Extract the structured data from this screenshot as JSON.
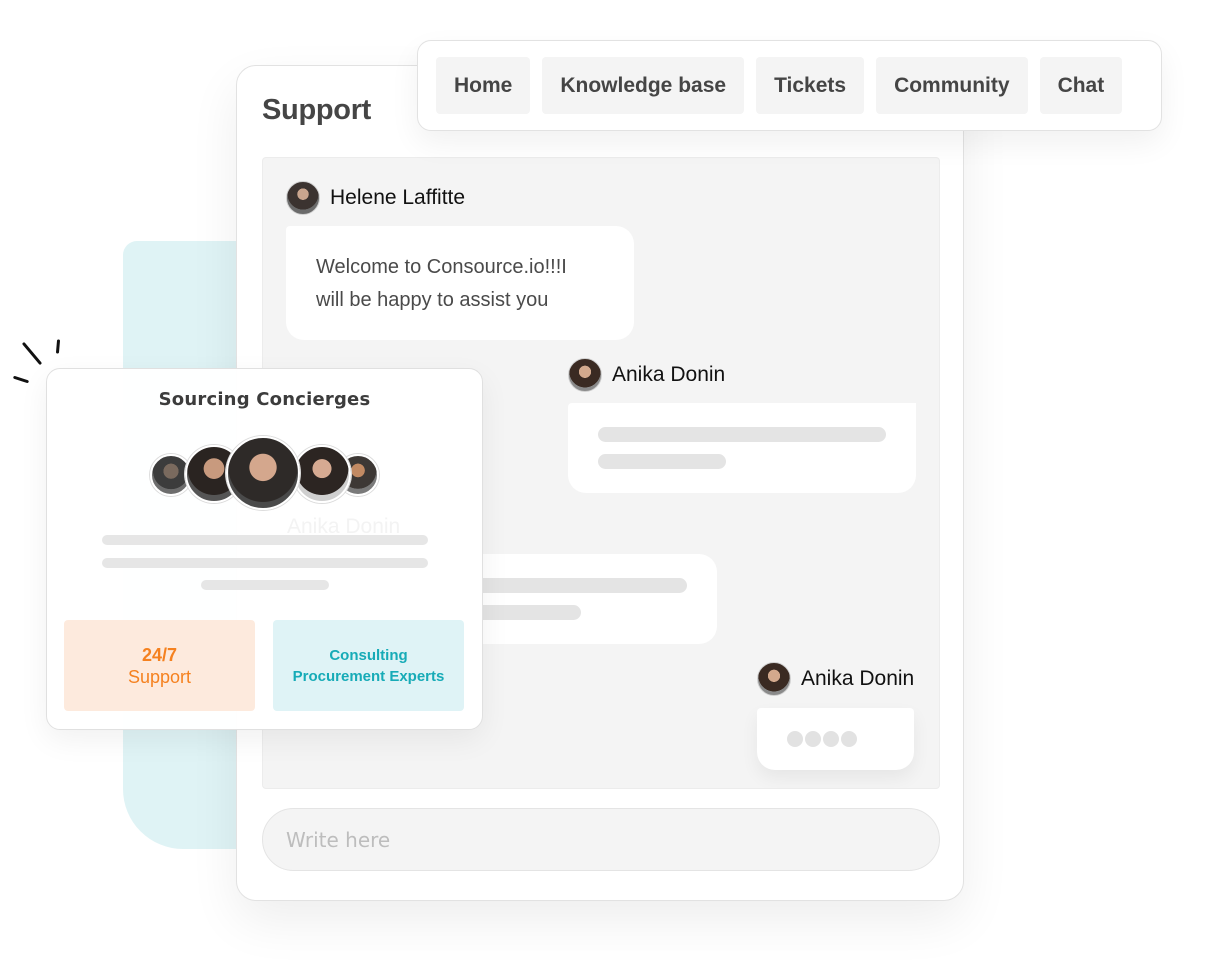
{
  "nav": {
    "items": [
      {
        "label": "Home"
      },
      {
        "label": "Knowledge base"
      },
      {
        "label": "Tickets"
      },
      {
        "label": "Community"
      },
      {
        "label": "Chat"
      }
    ]
  },
  "support": {
    "title": "Support",
    "messages": [
      {
        "sender": "Helene Laffitte",
        "avatar": "helene-avatar",
        "text_line1": "Welcome to Consource.io!!!I",
        "text_line2": "will be happy to assist you"
      },
      {
        "sender": "Anika Donin",
        "avatar": "anika-avatar",
        "placeholder": true
      },
      {
        "sender": "Anika Donin",
        "placeholder": true
      },
      {
        "sender": "Anika Donin",
        "avatar": "anika-avatar",
        "typing": true
      }
    ],
    "input": {
      "placeholder": "Write here",
      "value": ""
    }
  },
  "popup": {
    "title": "Sourcing Concierges",
    "ghost_text": "Anika Donin",
    "features": [
      {
        "line1": "24/7",
        "line2": "Support",
        "color": "#f5811f",
        "bg": "#fdeadd"
      },
      {
        "line1": "Consulting",
        "line2": "Procurement Experts",
        "color": "#17abb7",
        "bg": "#dff3f6"
      }
    ]
  },
  "colors": {
    "accent_orange": "#f5811f",
    "accent_teal": "#17abb7",
    "teal_block": "#dff3f5",
    "chat_bg": "#f4f4f4"
  }
}
